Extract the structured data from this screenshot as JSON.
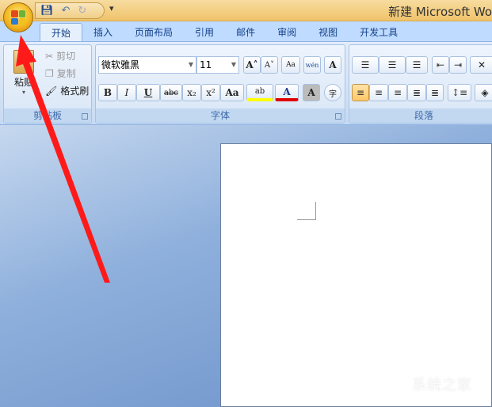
{
  "window": {
    "title": "新建 Microsoft Wo"
  },
  "qat": {
    "more": "▾"
  },
  "tabs": [
    "开始",
    "插入",
    "页面布局",
    "引用",
    "邮件",
    "审阅",
    "视图",
    "开发工具"
  ],
  "clipboard": {
    "paste": "粘贴",
    "cut": "剪切",
    "copy": "复制",
    "format_painter": "格式刷",
    "label": "剪贴板"
  },
  "font": {
    "name": "微软雅黑",
    "size": "11",
    "label": "字体",
    "bold": "B",
    "italic": "I",
    "underline": "U",
    "strike": "abc",
    "sub": "x₂",
    "sup": "x²",
    "case": "Aa",
    "grow": "A˄",
    "shrink": "A˅",
    "clear": "Aa",
    "pinyin": "wén",
    "border": "A",
    "shade": "A",
    "circle": "字",
    "highlight": "ab",
    "color": "A"
  },
  "paragraph": {
    "label": "段落"
  },
  "watermark": "系统之家",
  "colors": {
    "highlight": "#ffff00",
    "font_color": "#e00000",
    "arrow": "#ff1a1a"
  }
}
